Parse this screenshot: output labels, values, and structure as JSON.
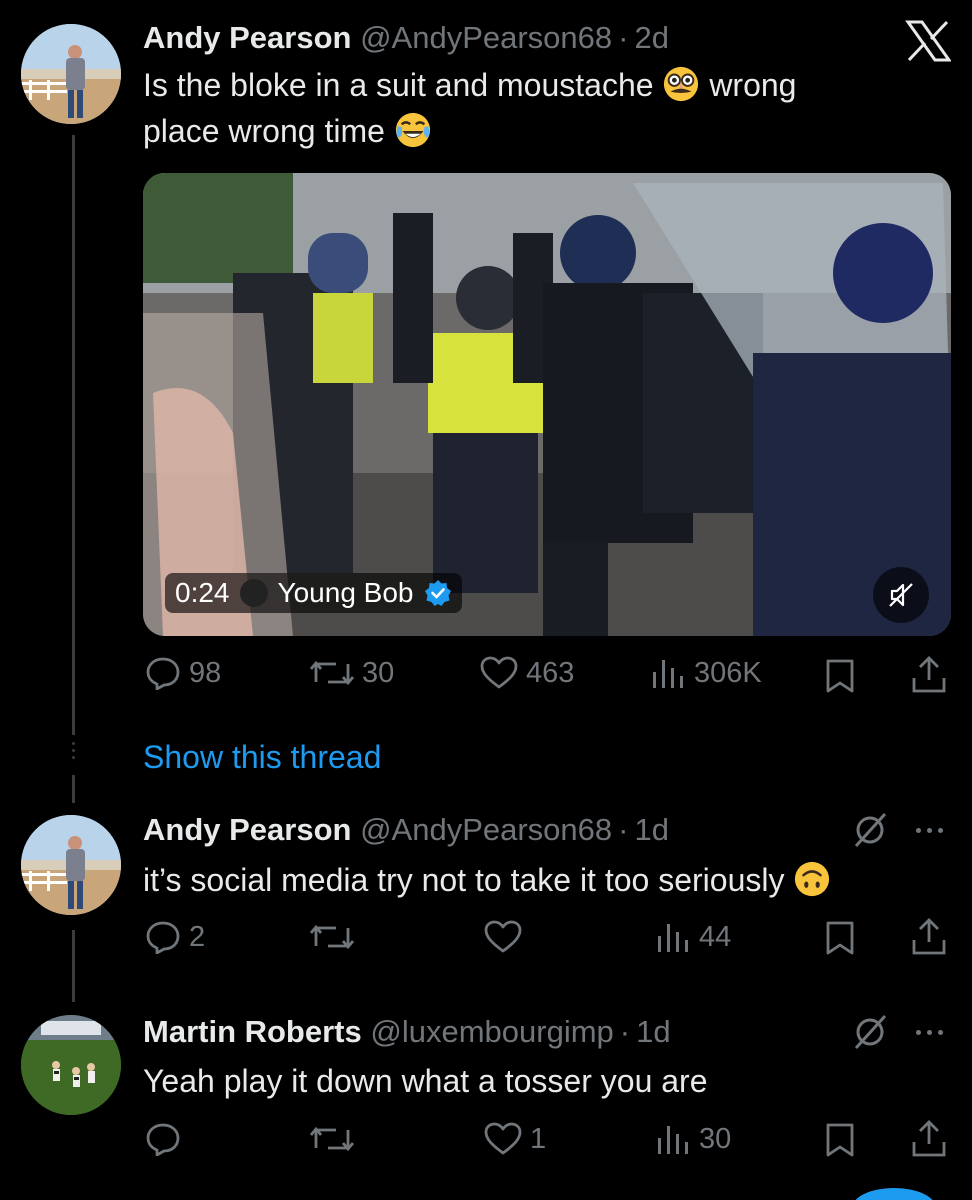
{
  "app": {
    "x_logo": "x-logo-icon"
  },
  "tweets": [
    {
      "name": "Andy Pearson",
      "handle": "@AndyPearson68",
      "time": "2d",
      "text_line1_a": "Is the bloke in a suit and moustache",
      "text_line1_b": "wrong",
      "text_line2": "place wrong time",
      "emoji_1": "disguised-face-emoji",
      "emoji_2": "tears-of-joy-emoji",
      "video": {
        "duration": "0:24",
        "source_name": "Young Bob",
        "verified": true,
        "mute_icon": "muted-speaker-icon"
      },
      "actions": {
        "replies": "98",
        "reposts": "30",
        "likes": "463",
        "views": "306K"
      }
    },
    {
      "name": "Andy Pearson",
      "handle": "@AndyPearson68",
      "time": "1d",
      "text": "it’s social media try not to take it too seriously",
      "emoji": "upside-down-face-emoji",
      "actions": {
        "replies": "2",
        "reposts": "",
        "likes": "",
        "views": "44"
      }
    },
    {
      "name": "Martin Roberts",
      "handle": "@luxembourgimp",
      "time": "1d",
      "text": "Yeah play it down what a tosser you are",
      "actions": {
        "replies": "",
        "reposts": "",
        "likes": "1",
        "views": "30"
      }
    }
  ],
  "show_thread": "Show this thread",
  "colors": {
    "background": "#000000",
    "text": "#e7e9ea",
    "muted": "#71767b",
    "accent": "#1d9bf0"
  }
}
